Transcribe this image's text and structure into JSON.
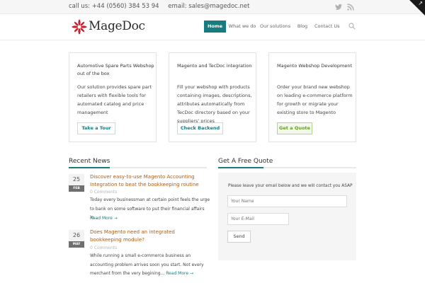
{
  "topbar": {
    "phone": "call us: +44 (0560) 384 53 94",
    "email": "email: sales@magedoc.net",
    "social_icons": [
      "twitter-icon",
      "rss-icon"
    ]
  },
  "header": {
    "logo_text": "MageDoc",
    "nav": [
      {
        "label": "Home",
        "active": true
      },
      {
        "label": "What we do",
        "active": false
      },
      {
        "label": "Our solutions",
        "active": false
      },
      {
        "label": "Blog",
        "active": false
      },
      {
        "label": "Contact Us",
        "active": false
      }
    ],
    "search_icon": "search-icon"
  },
  "features": [
    {
      "title": "Automotive Spare Parts Webshop out of the box",
      "text": "Our solution provides spare part retailers with flexible tools for automated catalog and price management",
      "button": "Take a Tour"
    },
    {
      "title": "Magento and TecDoc integration",
      "text": "Fill your webshop with products containing images, descriptions, attributes automatically from TecDoc directory based on your suppliers' prices",
      "button": "Check Backend"
    },
    {
      "title": "Magento Webshop Development",
      "text": "Order your brand new webshop on leading e-commerce platform for growth or migrate your existing store to Magento",
      "button": "Get a Quote"
    }
  ],
  "news": {
    "heading": "Recent News",
    "posts": [
      {
        "day": "25",
        "month": "FEB",
        "title": "Discover easy-to-use Magento Accounting Integration to beat the bookkeeping routine",
        "comments": "0 Comments",
        "excerpt": "Today every businessman  at certain point feels the urge to bank on some software to put their financial affairs in...",
        "read_more": "Read More →"
      },
      {
        "day": "26",
        "month": "MAY",
        "title": "Does Magento need an integrated bookkeeping module?",
        "comments": "0 Comments",
        "excerpt": "While running a small e-commerce business an accounting problem arrives soon you start. Not every merchant from the very begining...",
        "read_more": "Read More →"
      }
    ]
  },
  "quote": {
    "heading": "Get A Free Quote",
    "description": "Please leave your email below and we will contact you ASAP",
    "name_placeholder": "Your Name",
    "email_placeholder": "Your E-Mail",
    "send_label": "Send"
  },
  "colors": {
    "accent": "#167c80",
    "link_orange": "#b25b0d",
    "logo_red": "#c8202f"
  }
}
